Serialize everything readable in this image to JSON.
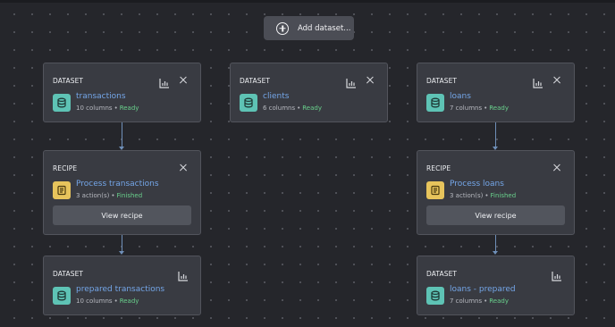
{
  "toolbar": {
    "add_dataset_label": "Add dataset...",
    "add_icon": "plus-circle-icon"
  },
  "colors": {
    "background": "#25262b",
    "card": "#393b42",
    "link": "#74a6e8",
    "dataset_icon": "#5ec3b5",
    "recipe_icon": "#e7c45c",
    "status_ready": "#69d08c",
    "connector": "#6f8fb8"
  },
  "nodes": {
    "transactions": {
      "type_label": "DATASET",
      "name": "transactions",
      "columns": "10 columns",
      "separator": "•",
      "status": "Ready",
      "icon": "database-icon",
      "actions": [
        "chart-icon",
        "close-icon"
      ]
    },
    "clients": {
      "type_label": "DATASET",
      "name": "clients",
      "columns": "6 columns",
      "separator": "•",
      "status": "Ready",
      "icon": "database-icon",
      "actions": [
        "chart-icon",
        "close-icon"
      ]
    },
    "loans": {
      "type_label": "DATASET",
      "name": "loans",
      "columns": "7 columns",
      "separator": "•",
      "status": "Ready",
      "icon": "database-icon",
      "actions": [
        "chart-icon",
        "close-icon"
      ]
    },
    "recipe_transactions": {
      "type_label": "RECIPE",
      "name": "Process transactions",
      "actions_count": "3 action(s)",
      "separator": "•",
      "status": "Finished",
      "icon": "recipe-icon",
      "view_label": "View recipe"
    },
    "recipe_loans": {
      "type_label": "RECIPE",
      "name": "Process loans",
      "actions_count": "3 action(s)",
      "separator": "•",
      "status": "Finished",
      "icon": "recipe-icon",
      "view_label": "View recipe"
    },
    "prepared_transactions": {
      "type_label": "DATASET",
      "name": "prepared transactions",
      "columns": "10 columns",
      "separator": "•",
      "status": "Ready",
      "icon": "database-icon",
      "actions": [
        "chart-icon"
      ]
    },
    "loans_prepared": {
      "type_label": "DATASET",
      "name": "loans - prepared",
      "columns": "7 columns",
      "separator": "•",
      "status": "Ready",
      "icon": "database-icon",
      "actions": [
        "chart-icon"
      ]
    }
  }
}
